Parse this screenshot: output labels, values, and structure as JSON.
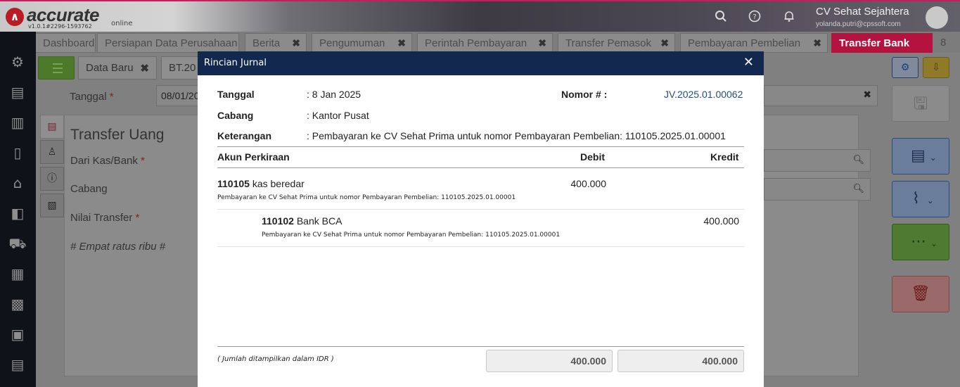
{
  "app": {
    "logo_text": "accurate",
    "logo_online": "online",
    "version": "v1.0.1#2296-1593762",
    "company": "CV Sehat Sejahtera",
    "email": "yolanda.putri@cpssoft.com"
  },
  "tabs": [
    {
      "label": "Dashboard"
    },
    {
      "label": "Persiapan Data Perusahaan"
    },
    {
      "label": "Berita"
    },
    {
      "label": "Pengumuman"
    },
    {
      "label": "Perintah Pembayaran"
    },
    {
      "label": "Transfer Pemasok"
    },
    {
      "label": "Pembayaran Pembelian"
    },
    {
      "label": "Transfer Bank"
    },
    {
      "label": "8"
    }
  ],
  "subtabs": {
    "new_label": "Data Baru",
    "record_label": "BT.20"
  },
  "form": {
    "tanggal_label": "Tanggal",
    "tanggal_value": "08/01/20",
    "title": "Transfer Uang",
    "dari_label": "Dari Kas/Bank",
    "cabang_label": "Cabang",
    "nilai_label": "Nilai Transfer",
    "terbilang": "# Empat ratus ribu #",
    "required_mark": "*"
  },
  "modal": {
    "title": "Rincian Jurnal",
    "close": "✕",
    "tanggal_label": "Tanggal",
    "tanggal_value": ": 8 Jan 2025",
    "nomor_label": "Nomor # :",
    "nomor_value": "JV.2025.01.00062",
    "cabang_label": "Cabang",
    "cabang_value": ": Kantor Pusat",
    "keterangan_label": "Keterangan",
    "keterangan_value": ": Pembayaran ke CV Sehat Prima untuk nomor Pembayaran Pembelian: 110105.2025.01.00001",
    "col_akun": "Akun Perkiraan",
    "col_debit": "Debit",
    "col_kredit": "Kredit",
    "rows": [
      {
        "code": "110105",
        "name": "kas beredar",
        "desc": "Pembayaran ke CV Sehat Prima untuk nomor Pembayaran Pembelian: 110105.2025.01.00001",
        "debit": "400.000",
        "kredit": ""
      },
      {
        "code": "110102",
        "name": "Bank BCA",
        "desc": "Pembayaran ke CV Sehat Prima untuk nomor Pembayaran Pembelian: 110105.2025.01.00001",
        "debit": "",
        "kredit": "400.000"
      }
    ],
    "footnote": "( Jumlah ditampilkan dalam IDR )",
    "total_debit": "400.000",
    "total_kredit": "400.000"
  },
  "colors": {
    "modal_header": "#12284f",
    "active_tab": "#b4123f",
    "journal_link": "#1f4e8c"
  }
}
